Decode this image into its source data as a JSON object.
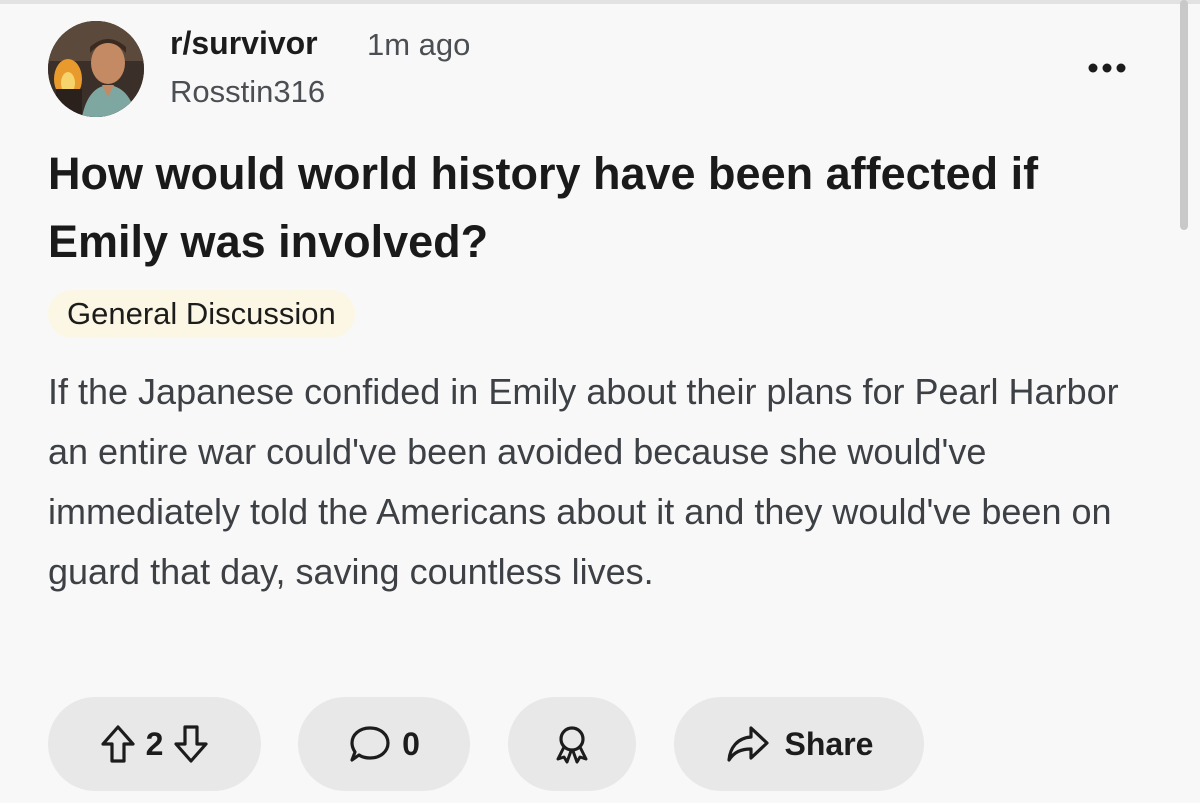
{
  "post": {
    "subreddit": "r/survivor",
    "time": "1m ago",
    "author": "Rosstin316",
    "title": "How would world history have been affected if Emily was involved?",
    "flair": "General Discussion",
    "body": "If the Japanese confided in Emily about their plans for Pearl Harbor an entire war could've been avoided because she would've immediately told the Americans about it and they would've been on guard that day, saving countless lives."
  },
  "actions": {
    "vote_count": "2",
    "comment_count": "0",
    "share_label": "Share"
  },
  "icons": {
    "avatar": "avatar-image",
    "more": "more-options-icon",
    "upvote": "upvote-arrow-icon",
    "downvote": "downvote-arrow-icon",
    "comment": "comment-bubble-icon",
    "award": "award-icon",
    "share": "share-arrow-icon"
  },
  "colors": {
    "background": "#f8f8f8",
    "pill": "#e8e8e8",
    "flair": "#fcf7e4",
    "text_primary": "#1a1a1b",
    "text_secondary": "#4b4f53"
  }
}
